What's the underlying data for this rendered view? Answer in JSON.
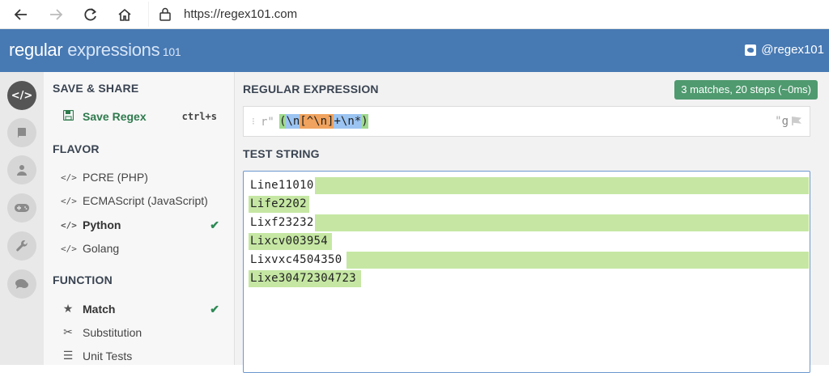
{
  "browser": {
    "url": "https://regex101.com",
    "buttons": [
      "back",
      "forward",
      "reload",
      "home"
    ]
  },
  "header": {
    "logo_regular": "regular",
    "logo_expressions": " expressions",
    "logo_version": " 101",
    "twitter": "@regex101"
  },
  "rail": [
    "code-icon",
    "book-icon",
    "user-icon",
    "gamepad-icon",
    "wrench-icon",
    "chat-icon"
  ],
  "sidebar": {
    "save_share": {
      "title": "SAVE & SHARE",
      "save_label": "Save Regex",
      "shortcut": "ctrl+s"
    },
    "flavor": {
      "title": "FLAVOR",
      "items": [
        {
          "label": "PCRE (PHP)"
        },
        {
          "label": "ECMAScript (JavaScript)"
        },
        {
          "label": "Python",
          "selected": true
        },
        {
          "label": "Golang"
        }
      ]
    },
    "function": {
      "title": "FUNCTION",
      "items": [
        {
          "label": "Match",
          "selected": true
        },
        {
          "label": "Substitution"
        },
        {
          "label": "Unit Tests"
        }
      ]
    }
  },
  "main": {
    "regex_title": "REGULAR EXPRESSION",
    "match_info": "3 matches, 20 steps (~0ms)",
    "regex_prefix": "r\"",
    "regex_tokens": [
      {
        "text": "(",
        "kind": "grp"
      },
      {
        "text": "\\n",
        "kind": "esc"
      },
      {
        "text": "[^\\n]",
        "kind": "cls"
      },
      {
        "text": "+",
        "kind": "esc"
      },
      {
        "text": "\\n*",
        "kind": "esc"
      },
      {
        "text": ")",
        "kind": "grp"
      }
    ],
    "regex_suffix": "\"",
    "regex_flags": "g",
    "test_title": "TEST STRING",
    "test_lines": [
      {
        "text": "Line11010",
        "highlight": "trail"
      },
      {
        "text": "Life2202",
        "highlight": "text"
      },
      {
        "text": "Lixf23232",
        "highlight": "trail"
      },
      {
        "text": "Lixcv003954",
        "highlight": "text"
      },
      {
        "text": "Lixvxc4504350",
        "highlight": "trail"
      },
      {
        "text": "Lixe30472304723",
        "highlight": "text"
      }
    ]
  },
  "colors": {
    "header": "#4779b3",
    "match_badge": "#4f9a6f",
    "match_highlight": "#c5e7a3"
  }
}
